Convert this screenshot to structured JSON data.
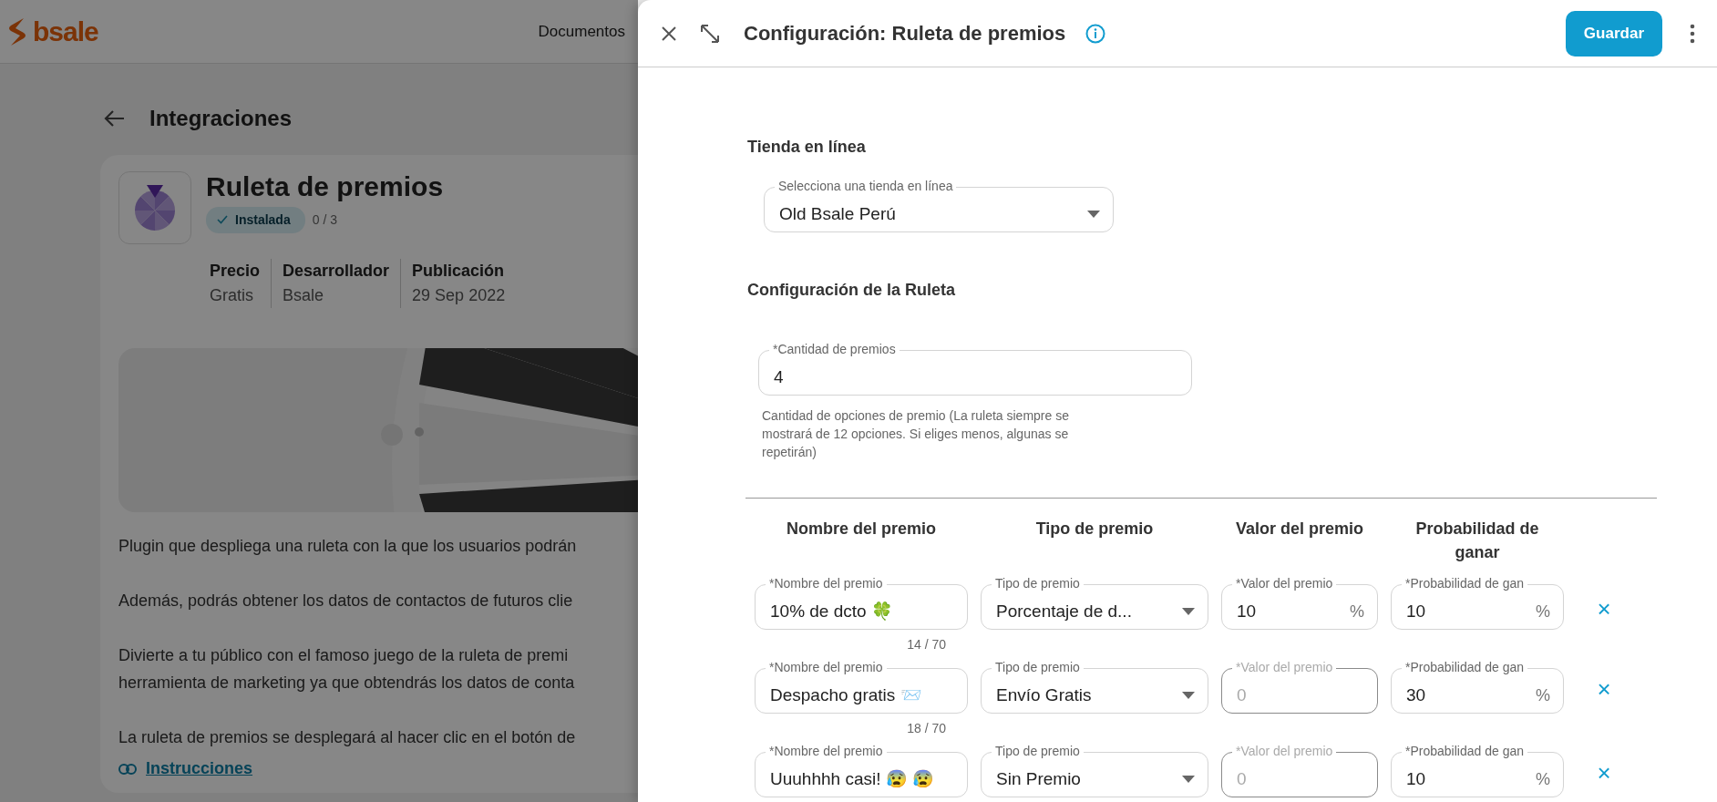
{
  "app_header": {
    "logo": "bsale",
    "nav": [
      "Documentos"
    ]
  },
  "page": {
    "title": "Integraciones",
    "app": {
      "name": "Ruleta de premios",
      "status": "Instalada",
      "count": "0 / 3",
      "meta": [
        {
          "label": "Precio",
          "value": "Gratis"
        },
        {
          "label": "Desarrollador",
          "value": "Bsale"
        },
        {
          "label": "Publicación",
          "value": "29 Sep 2022"
        }
      ]
    },
    "description": [
      [
        "Plugin que despliega una ruleta con la que los usuarios podrán"
      ],
      [
        "Además, podrás obtener los datos de contactos de futuros clie"
      ],
      [
        "Divierte a tu público con el famoso juego de la ruleta de premi",
        "herramienta de marketing ya que obtendrás los datos de conta"
      ],
      [
        "La ruleta de premios se desplegará al hacer clic en el botón de"
      ]
    ],
    "link": "Instrucciones"
  },
  "drawer": {
    "title": "Configuración: Ruleta de premios",
    "save": "Guardar",
    "store_section": {
      "heading": "Tienda en línea",
      "field": {
        "label": "Selecciona una tienda en línea",
        "value": "Old Bsale Perú"
      }
    },
    "roulette_section": {
      "heading": "Configuración de la Ruleta",
      "field": {
        "label": "*Cantidad de premios",
        "value": "4",
        "help": "Cantidad de opciones de premio (La ruleta siempre se mostrará de 12 opciones. Si eliges menos, algunas se repetirán)"
      }
    },
    "prize_table": {
      "columns": [
        "Nombre del premio",
        "Tipo de premio",
        "Valor del premio",
        "Probabilidad de ganar"
      ],
      "rows": [
        {
          "name": {
            "label": "*Nombre del premio",
            "value": "10% de dcto 🍀",
            "counter": "14 / 70"
          },
          "type": {
            "label": "Tipo de premio",
            "value": "Porcentaje de d..."
          },
          "amount": {
            "label": "*Valor del premio",
            "value": "10",
            "suffix": "%",
            "disabled": false
          },
          "probability": {
            "label": "*Probabilidad de gan",
            "value": "10",
            "suffix": "%"
          },
          "remove": "×"
        },
        {
          "name": {
            "label": "*Nombre del premio",
            "value": "Despacho gratis 📨",
            "counter": "18 / 70"
          },
          "type": {
            "label": "Tipo de premio",
            "value": "Envío Gratis"
          },
          "amount": {
            "label": "*Valor del premio",
            "placeholder": "0",
            "disabled": true
          },
          "probability": {
            "label": "*Probabilidad de gan",
            "value": "30",
            "suffix": "%"
          },
          "remove": "×"
        },
        {
          "name": {
            "label": "*Nombre del premio",
            "value": "Uuuhhhh casi! 😰 😰"
          },
          "type": {
            "label": "Tipo de premio",
            "value": "Sin Premio"
          },
          "amount": {
            "label": "*Valor del premio",
            "placeholder": "0",
            "disabled": true
          },
          "probability": {
            "label": "*Probabilidad de gan",
            "value": "10",
            "suffix": "%"
          },
          "remove": "×"
        }
      ]
    }
  }
}
